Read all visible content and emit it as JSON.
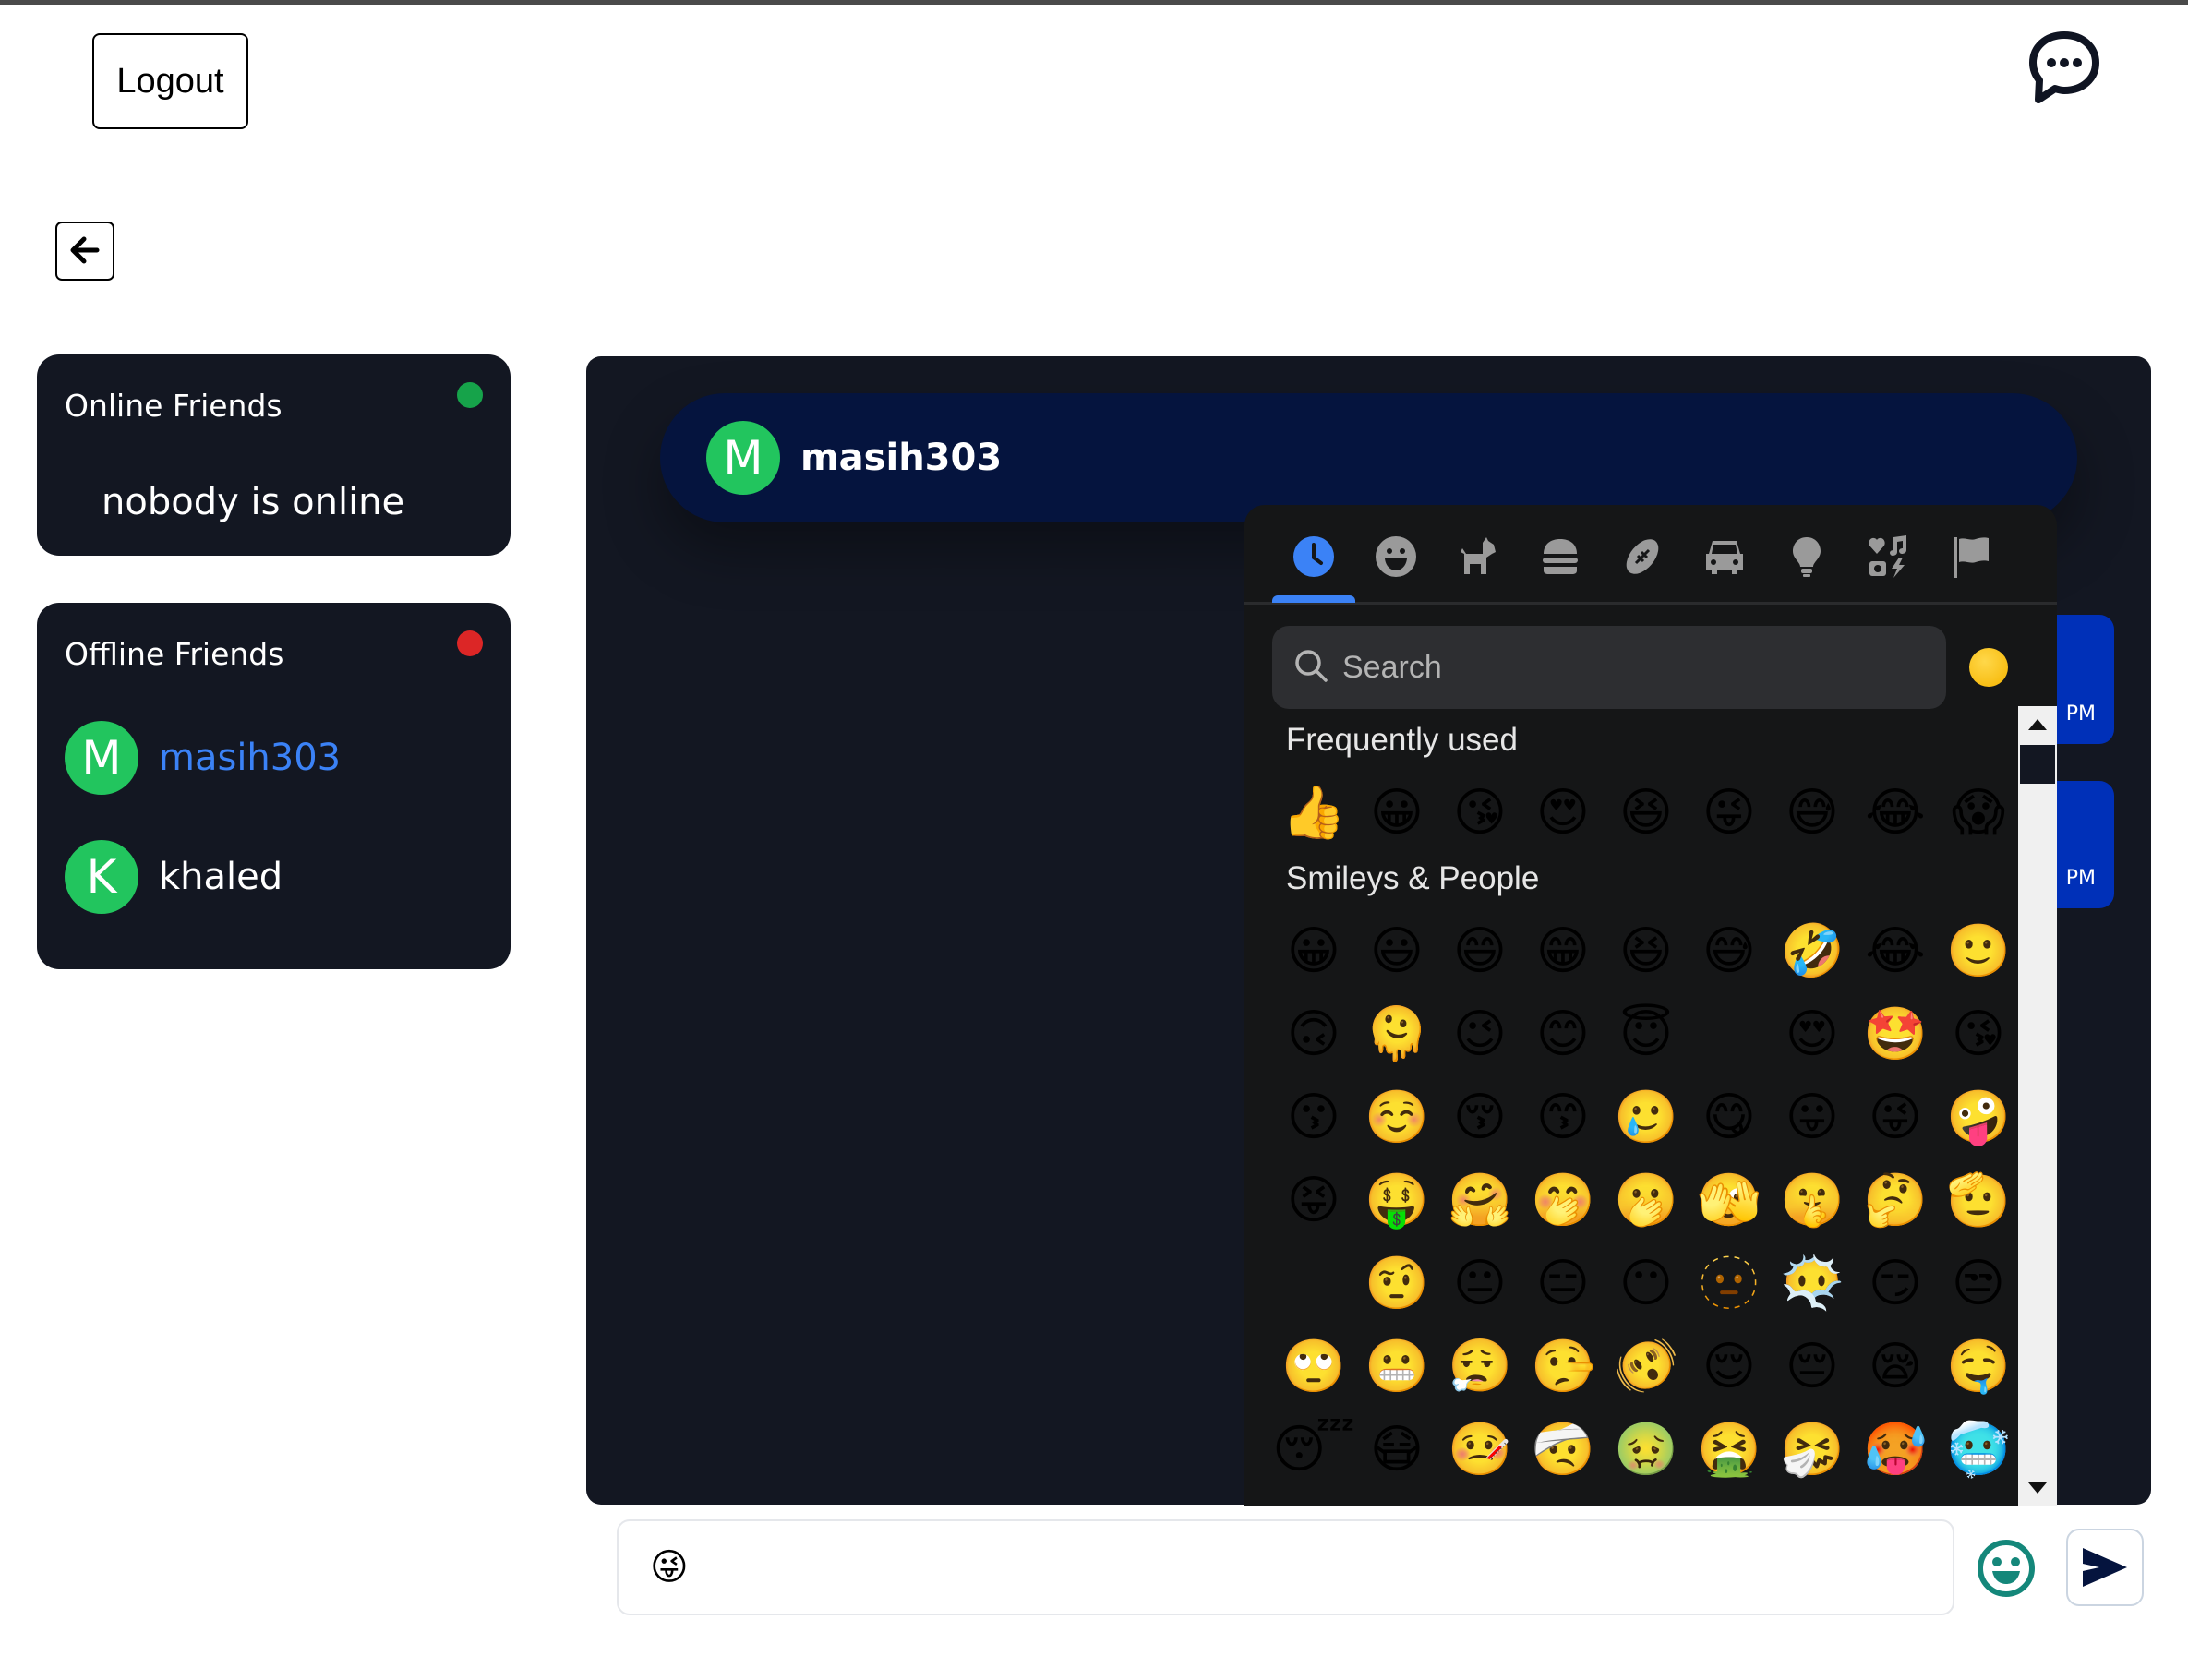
{
  "topbar": {
    "logout_label": "Logout",
    "chat_icon": "chat-bubble-dots-icon"
  },
  "nav": {
    "back_icon": "arrow-left-icon"
  },
  "sidebar": {
    "online": {
      "title": "Online Friends",
      "status_color": "#16a34a",
      "empty_text": "nobody is online"
    },
    "offline": {
      "title": "Offline Friends",
      "status_color": "#dc2626",
      "friends": [
        {
          "initial": "M",
          "name": "masih303",
          "active": true,
          "name_color": "#3b82f6"
        },
        {
          "initial": "K",
          "name": "khaled",
          "active": false,
          "name_color": "#ffffff"
        }
      ]
    }
  },
  "chat": {
    "header": {
      "initial": "M",
      "name": "masih303"
    },
    "messages": [
      {
        "time_visible": "PM"
      },
      {
        "time_visible": "PM"
      }
    ],
    "colors": {
      "panel_bg": "#131722",
      "header_bg": "#05143e",
      "bubble_bg": "#0030b8",
      "avatar_bg": "#22c55e"
    }
  },
  "emoji_picker": {
    "tabs": [
      {
        "name": "recent",
        "icon": "clock-icon",
        "active": true
      },
      {
        "name": "smileys",
        "icon": "smiley-icon",
        "active": false
      },
      {
        "name": "animals",
        "icon": "dog-icon",
        "active": false
      },
      {
        "name": "food",
        "icon": "burger-icon",
        "active": false
      },
      {
        "name": "activities",
        "icon": "football-icon",
        "active": false
      },
      {
        "name": "travel",
        "icon": "car-icon",
        "active": false
      },
      {
        "name": "objects",
        "icon": "lightbulb-icon",
        "active": false
      },
      {
        "name": "symbols",
        "icon": "symbols-icon",
        "active": false
      },
      {
        "name": "flags",
        "icon": "flag-icon",
        "active": false
      }
    ],
    "search_placeholder": "Search",
    "active_color": "#3b82f6",
    "sections": [
      {
        "title": "Frequently used",
        "rows": [
          [
            "👍",
            "😀",
            "😘",
            "😍",
            "😆",
            "😜",
            "😅",
            "😂",
            "😱"
          ]
        ]
      },
      {
        "title": "Smileys & People",
        "rows": [
          [
            "😀",
            "😃",
            "😄",
            "😁",
            "😆",
            "😅",
            "🤣",
            "😂",
            "🙂"
          ],
          [
            "🙃",
            "🫠",
            "😉",
            "😊",
            "😇",
            "",
            "😍",
            "🤩",
            "😘"
          ],
          [
            "😗",
            "☺️",
            "😚",
            "😙",
            "🥲",
            "😋",
            "😛",
            "😜",
            "🤪"
          ],
          [
            "😝",
            "🤑",
            "🤗",
            "🤭",
            "🫢",
            "🫣",
            "🤫",
            "🤔",
            "🫡"
          ],
          [
            "",
            "🤨",
            "😐",
            "😑",
            "😶",
            "🫥",
            "😶‍🌫️",
            "😏",
            "😒"
          ],
          [
            "🙄",
            "😬",
            "😮‍💨",
            "🤥",
            "🫨",
            "😌",
            "😔",
            "😪",
            "🤤"
          ],
          [
            "😴",
            "😷",
            "🤒",
            "🤕",
            "🤢",
            "🤮",
            "🤧",
            "🥵",
            "🥶"
          ]
        ]
      }
    ]
  },
  "composer": {
    "value": "😜",
    "placeholder": "",
    "emoji_button_icon": "smiley-icon",
    "emoji_button_color": "#14877a",
    "send_icon": "send-icon",
    "send_color": "#05143e"
  }
}
